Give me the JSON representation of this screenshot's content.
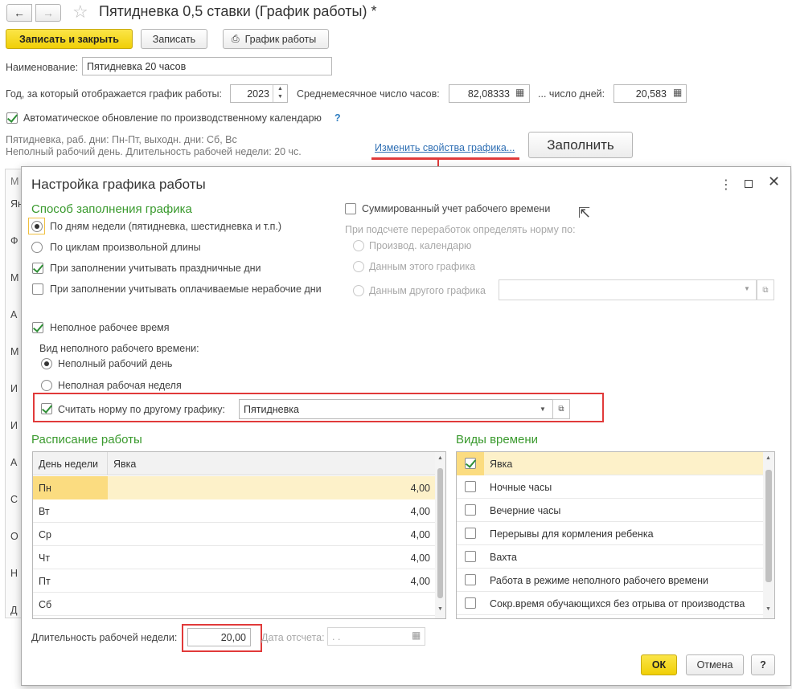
{
  "window": {
    "title": "Пятидневка 0,5 ставки (График работы) *"
  },
  "toolbar": {
    "save_close": "Записать и закрыть",
    "save": "Записать",
    "schedule": "График работы"
  },
  "form": {
    "name_label": "Наименование:",
    "name_value": "Пятидневка 20 часов",
    "year_label": "Год, за который отображается график работы:",
    "year_value": "2023",
    "avg_hours_label": "Среднемесячное число часов:",
    "avg_hours_value": "82,08333",
    "days_label": "... число дней:",
    "days_value": "20,583",
    "auto_update_label": "Автоматическое обновление по производственному календарю",
    "help": "?",
    "info_line1": "Пятидневка, раб. дни: Пн-Пт, выходн. дни: Сб, Вс",
    "info_line2": "Неполный рабочий день. Длительность рабочей недели: 20 чс.",
    "change_link": "Изменить свойства графика...",
    "fill_button": "Заполнить"
  },
  "bg_list": {
    "header": "М",
    "items": [
      "Ян",
      "Ф",
      "М",
      "А",
      "М",
      "И",
      "И",
      "А",
      "С",
      "О",
      "Н",
      "Д"
    ]
  },
  "dialog": {
    "title": "Настройка графика работы",
    "fill_method_title": "Способ заполнения графика",
    "opt_weekdays": "По дням недели (пятидневка, шестидневка и т.п.)",
    "opt_cycles": "По циклам произвольной длины",
    "cb_holidays": "При заполнении учитывать праздничные дни",
    "cb_paid_nonwork": "При заполнении учитывать оплачиваемые нерабочие дни",
    "cb_summarized": "Суммированный учет рабочего времени",
    "overtime_label": "При подсчете переработок определять норму по:",
    "opt_prod_calendar": "Производ. календарю",
    "opt_this_schedule": "Данным этого графика",
    "opt_other_schedule": "Данным другого графика",
    "cb_part_time": "Неполное рабочее время",
    "part_time_kind_label": "Вид неполного рабочего времени:",
    "opt_part_day": "Неполный рабочий день",
    "opt_part_week": "Неполная рабочая неделя",
    "cb_norm_other": "Считать норму по другому графику:",
    "norm_other_value": "Пятидневка",
    "schedule_title": "Расписание работы",
    "schedule_cols": [
      "День недели",
      "Явка"
    ],
    "schedule_rows": [
      {
        "day": "Пн",
        "value": "4,00"
      },
      {
        "day": "Вт",
        "value": "4,00"
      },
      {
        "day": "Ср",
        "value": "4,00"
      },
      {
        "day": "Чт",
        "value": "4,00"
      },
      {
        "day": "Пт",
        "value": "4,00"
      },
      {
        "day": "Сб",
        "value": ""
      }
    ],
    "time_types_title": "Виды времени",
    "time_types": [
      {
        "label": "Явка",
        "checked": true
      },
      {
        "label": "Ночные часы",
        "checked": false
      },
      {
        "label": "Вечерние часы",
        "checked": false
      },
      {
        "label": "Перерывы для кормления ребенка",
        "checked": false
      },
      {
        "label": "Вахта",
        "checked": false
      },
      {
        "label": "Работа в режиме неполного рабочего времени",
        "checked": false
      },
      {
        "label": "Сокр.время обучающихся без отрыва от производства",
        "checked": false
      }
    ],
    "week_length_label": "Длительность рабочей недели:",
    "week_length_value": "20,00",
    "ref_date_label": "Дата отсчета:",
    "ref_date_value": " .  .",
    "ok": "ОК",
    "cancel": "Отмена",
    "help": "?"
  },
  "colors": {
    "accent_yellow": "#f3d412",
    "section_green": "#3a9a2e",
    "highlight_red": "#e13a3a",
    "selection": "#fbe9a8"
  }
}
